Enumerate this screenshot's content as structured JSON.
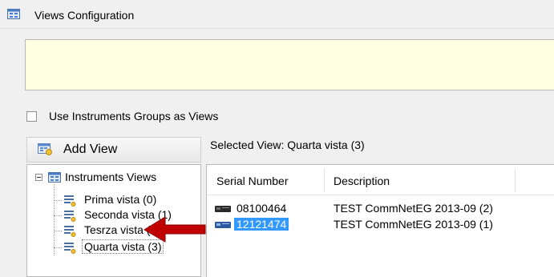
{
  "window": {
    "title": "Views Configuration",
    "icon": "grid-window-icon"
  },
  "options": {
    "use_groups_label": "Use Instruments Groups as Views",
    "use_groups_checked": false
  },
  "toolbar": {
    "add_view_label": "Add View",
    "add_view_icon": "add-view-icon"
  },
  "tree": {
    "root_label": "Instruments Views",
    "items": [
      {
        "label": "Prima vista (0)",
        "selected": false
      },
      {
        "label": "Seconda vista (1)",
        "selected": false
      },
      {
        "label": "Tesrza vista (2)",
        "selected": false
      },
      {
        "label": "Quarta vista (3)",
        "selected": true
      }
    ]
  },
  "selected_view": {
    "label": "Selected View: Quarta vista (3)"
  },
  "grid": {
    "columns": [
      "Serial Number",
      "Description"
    ],
    "rows": [
      {
        "serial": "08100464",
        "description": "TEST CommNetEG 2013-09 (2)",
        "selected": false
      },
      {
        "serial": "12121474",
        "description": "TEST CommNetEG 2013-09 (1)",
        "selected": true
      }
    ]
  },
  "colors": {
    "info_bg": "#ffffe1",
    "selection": "#3399ff",
    "arrow": "#c00000"
  }
}
